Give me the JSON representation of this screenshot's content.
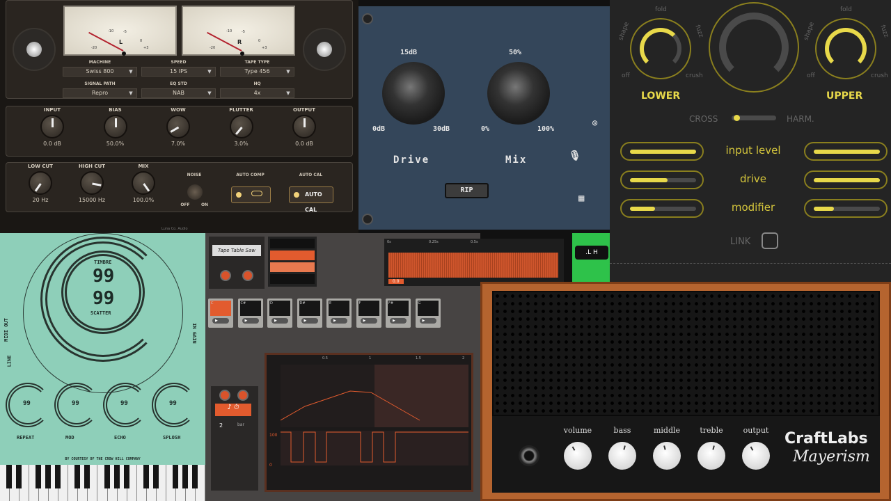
{
  "tape": {
    "meters": [
      {
        "channel": "L",
        "ticks": [
          "-20",
          "-10",
          "-5",
          "0",
          "+3"
        ]
      },
      {
        "channel": "R",
        "ticks": [
          "-20",
          "-10",
          "-5",
          "0",
          "+3"
        ]
      }
    ],
    "selectors": [
      {
        "label": "MACHINE",
        "value": "Swiss 800"
      },
      {
        "label": "SPEED",
        "value": "15 IPS"
      },
      {
        "label": "TAPE TYPE",
        "value": "Type 456"
      },
      {
        "label": "SIGNAL PATH",
        "value": "Repro"
      },
      {
        "label": "EQ STD",
        "value": "NAB"
      },
      {
        "label": "HQ",
        "value": "4x"
      }
    ],
    "knobs": [
      {
        "label": "INPUT",
        "value": "0.0 dB",
        "angle": 0
      },
      {
        "label": "BIAS",
        "value": "50.0%",
        "angle": 0
      },
      {
        "label": "WOW",
        "value": "7.0%",
        "angle": -120
      },
      {
        "label": "FLUTTER",
        "value": "3.0%",
        "angle": -140
      },
      {
        "label": "OUTPUT",
        "value": "0.0 dB",
        "angle": 0
      }
    ],
    "knobs2": [
      {
        "label": "LOW CUT",
        "value": "20 Hz",
        "angle": -145
      },
      {
        "label": "HIGH CUT",
        "value": "15000 Hz",
        "angle": 100
      },
      {
        "label": "MIX",
        "value": "100.0%",
        "angle": 145
      }
    ],
    "noise": {
      "label": "NOISE",
      "off": "OFF",
      "on": "ON"
    },
    "auto_comp": {
      "label": "AUTO COMP"
    },
    "auto_cal": {
      "label": "AUTO CAL",
      "button": "AUTO CAL"
    },
    "brand": "Luna Co. Audio"
  },
  "drive_unit": {
    "drive": {
      "label": "Drive",
      "top": "15dB",
      "min": "0dB",
      "max": "30dB"
    },
    "mix": {
      "label": "Mix",
      "top": "50%",
      "min": "0%",
      "max": "100%"
    },
    "rip_button": "RIP"
  },
  "bands": {
    "lower": {
      "title": "LOWER",
      "labels": {
        "fold": "fold",
        "shape": "shape",
        "fuzz": "fuzz",
        "off": "off",
        "crush": "crush"
      }
    },
    "upper": {
      "title": "UPPER",
      "labels": {
        "fold": "fold",
        "shape": "shape",
        "fuzz": "fuzz",
        "off": "off",
        "crush": "crush"
      }
    },
    "cross": "CROSS",
    "harm": "HARM.",
    "cross_value": 0.05,
    "rows": [
      {
        "label": "input level",
        "lower": 1.0,
        "upper": 1.0
      },
      {
        "label": "drive",
        "lower": 0.57,
        "upper": 1.0
      },
      {
        "label": "modifier",
        "lower": 0.38,
        "upper": 0.31
      }
    ],
    "link": "LINK",
    "accent": "#e8d94a"
  },
  "blueprint": {
    "timbre": {
      "label": "TIMBRE",
      "value": "99"
    },
    "scatter": {
      "label": "SCATTER",
      "value": "99"
    },
    "side_left": "MIDI OUT",
    "side_left2": "LINE",
    "side_right": "IN GAIN",
    "knobs": [
      {
        "label": "REPEAT",
        "value": "99"
      },
      {
        "label": "MOD",
        "value": "99"
      },
      {
        "label": "ECHO",
        "value": "99"
      },
      {
        "label": "SPLOSH",
        "value": "99"
      }
    ],
    "credit": "BY COURTESY OF THE CROW HILL COMPANY"
  },
  "sampler": {
    "logo": "Tape Table Saw",
    "slots": [
      "C",
      "C#",
      "D",
      "D#",
      "E",
      "F",
      "F#",
      "G"
    ],
    "timeline": [
      "0s",
      "0.25s",
      "0.5s"
    ],
    "gain": "0.0",
    "env_axis": [
      "0.5",
      "1",
      "1.5",
      "2"
    ],
    "step_value": "2",
    "step_unit": "bar",
    "level_max": "100",
    "level_min": "0",
    "accent": "#e25b2e"
  },
  "amp": {
    "knobs": [
      {
        "label": "volume",
        "angle": -30
      },
      {
        "label": "bass",
        "angle": 15
      },
      {
        "label": "middle",
        "angle": -15
      },
      {
        "label": "treble",
        "angle": 15
      },
      {
        "label": "output",
        "angle": -30
      }
    ],
    "brand": "CraftLabs",
    "model": "Mayerism"
  }
}
